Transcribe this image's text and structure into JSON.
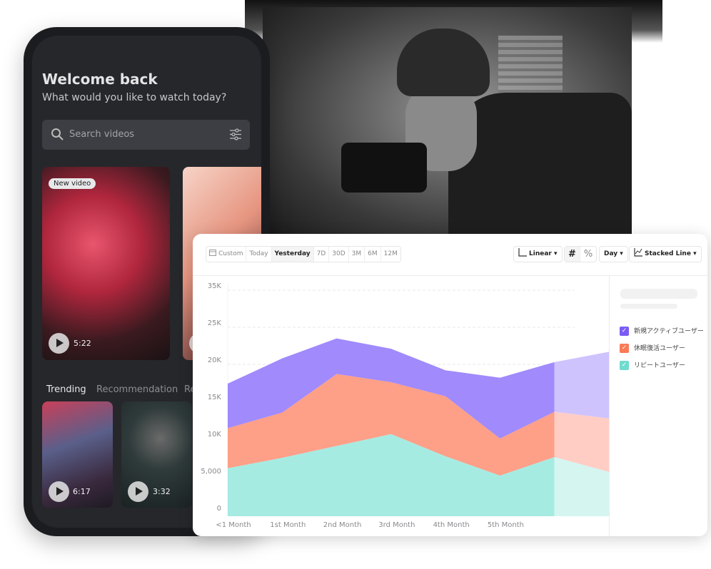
{
  "phone": {
    "title": "Welcome back",
    "subtitle": "What would you like to watch today?",
    "search_placeholder": "Search videos",
    "featured": [
      {
        "badge": "New video",
        "duration": "5:22"
      },
      {
        "duration": ""
      }
    ],
    "tabs": [
      "Trending",
      "Recommendation",
      "Re"
    ],
    "trending": [
      {
        "duration": "6:17"
      },
      {
        "duration": "3:32"
      }
    ]
  },
  "toolbar": {
    "ranges": [
      "Custom",
      "Today",
      "Yesterday",
      "7D",
      "30D",
      "3M",
      "6M",
      "12M"
    ],
    "selected_range": "Yesterday",
    "scale": "Linear",
    "number_mode": [
      "#",
      "%"
    ],
    "interval": "Day",
    "chart_type": "Stacked Line"
  },
  "legend": [
    {
      "label": "新規アクティブユーザー",
      "color": "#7b5cf5"
    },
    {
      "label": "休眠復活ユーザー",
      "color": "#fa7a55"
    },
    {
      "label": "リピートユーザー",
      "color": "#6fdccf"
    }
  ],
  "chart_data": {
    "type": "area",
    "stacked": true,
    "categories": [
      "<1 Month",
      "1st Month",
      "2nd Month",
      "3rd Month",
      "4th Month",
      "5th Month",
      "",
      ""
    ],
    "y_tick_labels": [
      "0",
      "5,000",
      "10K",
      "15K",
      "20K",
      "25K",
      "35K"
    ],
    "y_tick_values": [
      0,
      5000,
      10000,
      15000,
      20000,
      25000,
      30000
    ],
    "ylim": [
      0,
      30000
    ],
    "grid": true,
    "incomplete_from_index": 6,
    "series": [
      {
        "name": "リピートユーザー",
        "color": "#a6ebe2",
        "light": "#d5f5f1",
        "values": [
          6000,
          7400,
          9000,
          10600,
          7600,
          5000,
          7500,
          5500
        ]
      },
      {
        "name": "休眠復活ユーザー",
        "color": "#fe9f88",
        "light": "#ffcdc4",
        "values": [
          5400,
          6100,
          9700,
          7000,
          8100,
          5000,
          6100,
          7200
        ]
      },
      {
        "name": "新規アクティブユーザー",
        "color": "#a08afc",
        "light": "#cfc3fe",
        "values": [
          6000,
          7300,
          4800,
          4500,
          3500,
          8200,
          6700,
          9000
        ]
      }
    ]
  }
}
